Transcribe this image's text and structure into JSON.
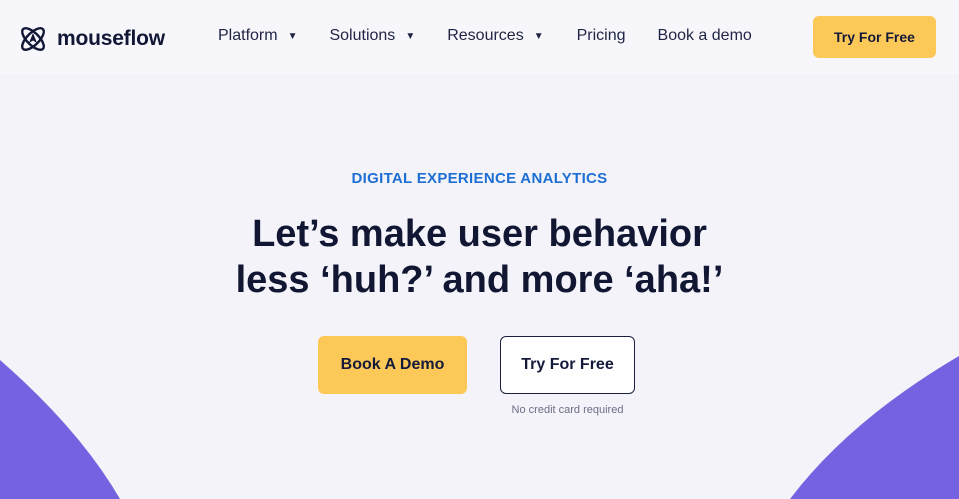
{
  "brand": {
    "name": "mouseflow",
    "logo_icon": "mouseflow-atom-logo-icon"
  },
  "nav": {
    "items": [
      {
        "label": "Platform",
        "has_dropdown": true
      },
      {
        "label": "Solutions",
        "has_dropdown": true
      },
      {
        "label": "Resources",
        "has_dropdown": true
      },
      {
        "label": "Pricing",
        "has_dropdown": false
      },
      {
        "label": "Book a demo",
        "has_dropdown": false
      }
    ],
    "caret_glyph": "▼",
    "cta_label": "Try For Free"
  },
  "hero": {
    "eyebrow": "DIGITAL EXPERIENCE ANALYTICS",
    "headline_line1": "Let’s make user behavior",
    "headline_line2": "less ‘huh?’ and more ‘aha!’",
    "primary_button": "Book A Demo",
    "secondary_button": "Try For Free",
    "note": "No credit card required"
  },
  "colors": {
    "accent_yellow": "#fcc858",
    "eyebrow_blue": "#1d6fd4",
    "shape_purple": "#7463e0",
    "text_dark": "#111633",
    "background": "#f3f3f9"
  }
}
